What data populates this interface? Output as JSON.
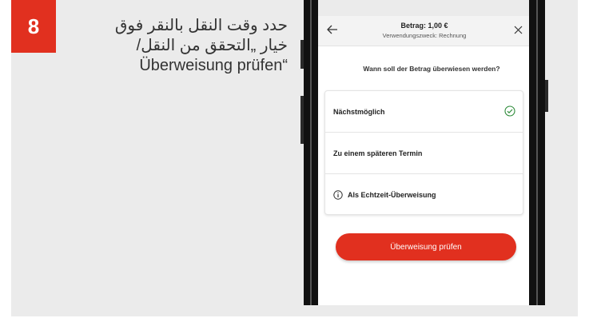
{
  "step": {
    "number": "8"
  },
  "instruction": {
    "lines": [
      "حدد وقت النقل بالنقر فوق",
      "خيار „التحقق من النقل/",
      "“Überweisung prüfen"
    ]
  },
  "topbar": {
    "title": "Betrag: 1,00 €",
    "subtitle": "Verwendungszweck: Rechnung",
    "back_icon": "arrow-left-icon",
    "close_icon": "close-icon"
  },
  "question": "Wann soll der Betrag überwiesen werden?",
  "options": [
    {
      "label": "Nächstmöglich",
      "selected": true
    },
    {
      "label": "Zu einem späteren Termin",
      "selected": false
    },
    {
      "label": "Als Echtzeit-Überweisung",
      "icon": "info-icon",
      "selected": false
    }
  ],
  "primary_button": {
    "label": "Überweisung prüfen"
  },
  "colors": {
    "accent": "#e1301f",
    "check": "#2e8b3a"
  }
}
